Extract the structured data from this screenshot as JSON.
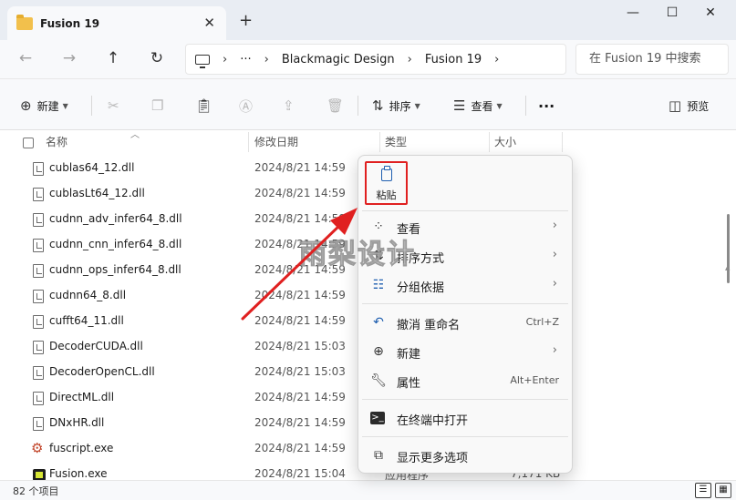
{
  "tab": {
    "title": "Fusion 19",
    "close": "✕",
    "new_tab": "+"
  },
  "window": {
    "minimize": "—",
    "maximize": "☐",
    "close": "✕"
  },
  "nav": {
    "back": "←",
    "forward": "→",
    "up": "↑",
    "refresh": "↻"
  },
  "breadcrumb": {
    "ellipsis": "···",
    "sep": "›",
    "items": [
      "Blackmagic Design",
      "Fusion 19"
    ]
  },
  "search": {
    "placeholder": "在 Fusion 19 中搜索"
  },
  "toolbar": {
    "new_label": "新建",
    "sort_label": "排序",
    "view_label": "查看",
    "more": "···",
    "preview_label": "预览"
  },
  "columns": {
    "name": "名称",
    "modified": "修改日期",
    "type": "类型",
    "size": "大小"
  },
  "files": [
    {
      "name": "cublas64_12.dll",
      "date": "2024/8/21 14:59",
      "type": "",
      "size": ""
    },
    {
      "name": "cublasLt64_12.dll",
      "date": "2024/8/21 14:59",
      "type": "",
      "size": ""
    },
    {
      "name": "cudnn_adv_infer64_8.dll",
      "date": "2024/8/21 14:59",
      "type": "",
      "size": ""
    },
    {
      "name": "cudnn_cnn_infer64_8.dll",
      "date": "2024/8/21 14:59",
      "type": "",
      "size": ""
    },
    {
      "name": "cudnn_ops_infer64_8.dll",
      "date": "2024/8/21 14:59",
      "type": "",
      "size": ""
    },
    {
      "name": "cudnn64_8.dll",
      "date": "2024/8/21 14:59",
      "type": "",
      "size": ""
    },
    {
      "name": "cufft64_11.dll",
      "date": "2024/8/21 14:59",
      "type": "",
      "size": ""
    },
    {
      "name": "DecoderCUDA.dll",
      "date": "2024/8/21 15:03",
      "type": "",
      "size": ""
    },
    {
      "name": "DecoderOpenCL.dll",
      "date": "2024/8/21 15:03",
      "type": "",
      "size": ""
    },
    {
      "name": "DirectML.dll",
      "date": "2024/8/21 14:59",
      "type": "",
      "size": ""
    },
    {
      "name": "DNxHR.dll",
      "date": "2024/8/21 14:59",
      "type": "",
      "size": ""
    },
    {
      "name": "fuscript.exe",
      "date": "2024/8/21 14:59",
      "type": "",
      "size": ""
    },
    {
      "name": "Fusion.exe",
      "date": "2024/8/21 15:04",
      "type": "应用程序",
      "size": "7,171 KB"
    }
  ],
  "status": {
    "count": "82 个项目"
  },
  "context_menu": {
    "paste": "粘贴",
    "items": [
      {
        "label": "查看",
        "shortcut": "",
        "arrow": "›"
      },
      {
        "label": "排序方式",
        "shortcut": "",
        "arrow": "›"
      },
      {
        "label": "分组依据",
        "shortcut": "",
        "arrow": "›"
      },
      {
        "label": "撤消 重命名",
        "shortcut": "Ctrl+Z",
        "arrow": ""
      },
      {
        "label": "新建",
        "shortcut": "",
        "arrow": "›"
      },
      {
        "label": "属性",
        "shortcut": "Alt+Enter",
        "arrow": ""
      },
      {
        "label": "在终端中打开",
        "shortcut": "",
        "arrow": ""
      },
      {
        "label": "显示更多选项",
        "shortcut": "",
        "arrow": ""
      }
    ]
  },
  "watermark": "雨梨设计",
  "colors": {
    "annotation_red": "#e02020",
    "accent_blue": "#1f5fb0"
  }
}
